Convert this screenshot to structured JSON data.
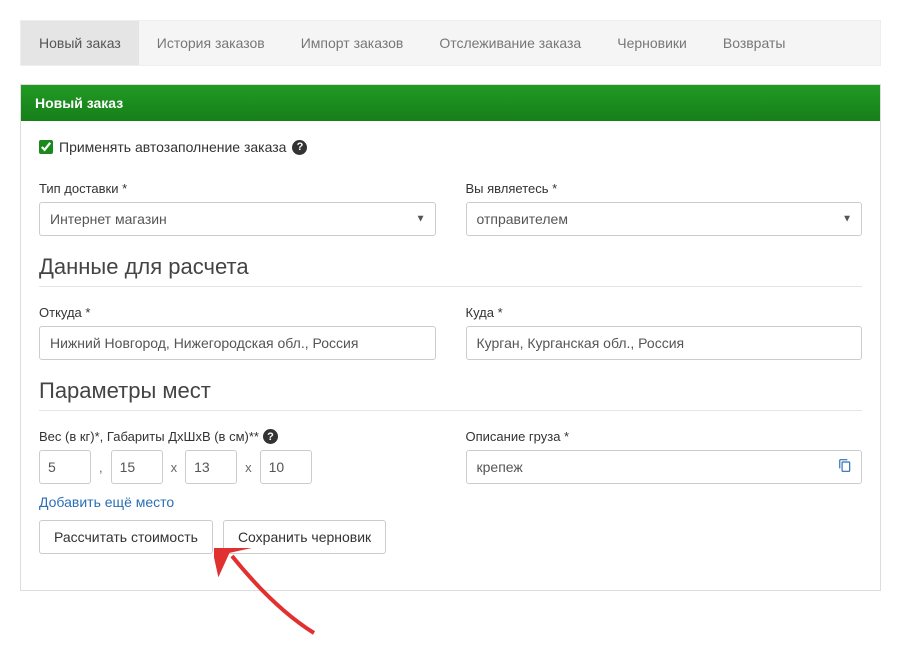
{
  "tabs": {
    "new_order": "Новый заказ",
    "history": "История заказов",
    "import": "Импорт заказов",
    "tracking": "Отслеживание заказа",
    "drafts": "Черновики",
    "returns": "Возвраты"
  },
  "panel": {
    "title": "Новый заказ"
  },
  "autofill": {
    "label": "Применять автозаполнение заказа"
  },
  "delivery_type": {
    "label": "Тип доставки *",
    "value": "Интернет магазин"
  },
  "role": {
    "label": "Вы являетесь *",
    "value": "отправителем"
  },
  "calc_section": {
    "title": "Данные для расчета"
  },
  "from": {
    "label": "Откуда *",
    "value": "Нижний Новгород, Нижегородская обл., Россия"
  },
  "to": {
    "label": "Куда *",
    "value": "Курган, Курганская обл., Россия"
  },
  "params_section": {
    "title": "Параметры мест"
  },
  "dims": {
    "label": "Вес (в кг)*, Габариты ДхШхВ (в см)**",
    "weight": "5",
    "l": "15",
    "w": "13",
    "h": "10",
    "comma": ",",
    "x": "х"
  },
  "desc": {
    "label": "Описание груза *",
    "value": "крепеж"
  },
  "add_more": "Добавить ещё место",
  "buttons": {
    "calculate": "Рассчитать стоимость",
    "save_draft": "Сохранить черновик"
  }
}
